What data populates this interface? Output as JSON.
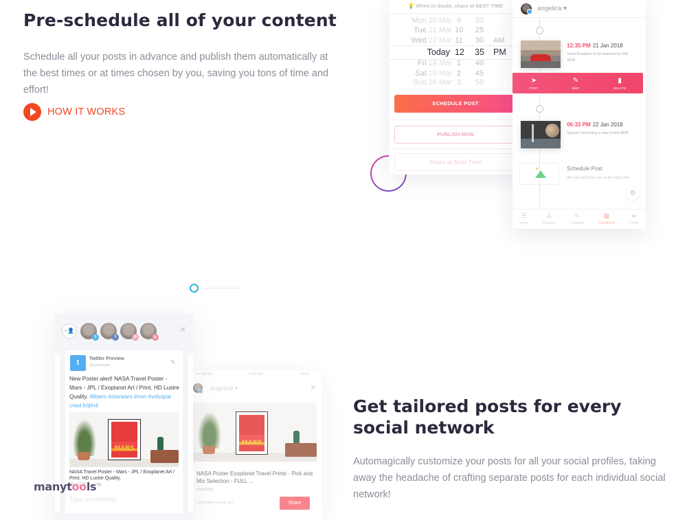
{
  "section_schedule": {
    "title": "Pre-schedule all of your content",
    "description": "Schedule all your posts in advance and publish them automatically at the best times or at times chosen by you, saving you tons of time and effort!",
    "cta_label": "HOW IT WORKS",
    "accent_color": "#f2461f"
  },
  "date_picker": {
    "tip": "When in doubt, share at BEST TIME",
    "rows": [
      {
        "day": "Mon",
        "date": "20 Mar",
        "hour": "9",
        "minute": "20",
        "ampm": ""
      },
      {
        "day": "Tue",
        "date": "21 Mar",
        "hour": "10",
        "minute": "25",
        "ampm": ""
      },
      {
        "day": "Wed",
        "date": "22 Mar",
        "hour": "11",
        "minute": "30",
        "ampm": "AM"
      },
      {
        "day": "Today",
        "date": "",
        "hour": "12",
        "minute": "35",
        "ampm": "PM"
      },
      {
        "day": "Fri",
        "date": "24 Mar",
        "hour": "1",
        "minute": "40",
        "ampm": ""
      },
      {
        "day": "Sat",
        "date": "25 Mar",
        "hour": "2",
        "minute": "45",
        "ampm": ""
      },
      {
        "day": "Sun",
        "date": "26 Mar",
        "hour": "3",
        "minute": "50",
        "ampm": ""
      }
    ],
    "schedule_button": "SCHEDULE POST",
    "publish_button": "PUBLISH NOW",
    "best_time_button": "Share at Best Time"
  },
  "timeline": {
    "username": "angelica",
    "posts": [
      {
        "time": "12:35 PM",
        "date": "21 Jan 2018",
        "description": "Tesla Roadster to hit markets by Mid 2018"
      },
      {
        "time": "06:33 PM",
        "date": "22 Jan 2018",
        "description": "SpaceX launching a new rocket BFR"
      }
    ],
    "actions": [
      {
        "icon": "send-icon",
        "glyph": "➤",
        "label": "POST"
      },
      {
        "icon": "pencil-icon",
        "glyph": "✎",
        "label": "EDIT"
      },
      {
        "icon": "trash-icon",
        "glyph": "🗑",
        "label": "DELETE"
      }
    ],
    "schedule_slot": {
      "title": "Schedule Post",
      "subtitle": "We will post it for you at the right time"
    },
    "tabs": [
      {
        "icon": "home-icon",
        "glyph": "☰",
        "label": "Home",
        "active": false
      },
      {
        "icon": "manage-icon",
        "glyph": "⟁",
        "label": "Manage",
        "active": false
      },
      {
        "icon": "compose-icon",
        "glyph": "✎",
        "label": "Compose",
        "active": false
      },
      {
        "icon": "calendar-icon",
        "glyph": "▦",
        "label": "Scheduled",
        "active": true
      },
      {
        "icon": "profile-icon",
        "glyph": "●",
        "label": "Profile",
        "active": false
      }
    ]
  },
  "composer": {
    "profiles": [
      {
        "network": "twitter",
        "badge_glyph": "t",
        "color": "#5bb6f0"
      },
      {
        "network": "facebook",
        "badge_glyph": "f",
        "color": "#6f86c4"
      },
      {
        "network": "instagram",
        "badge_glyph": "◎",
        "color": "#f3a3b8"
      },
      {
        "network": "pinterest",
        "badge_glyph": "p",
        "color": "#ef8a9a"
      }
    ],
    "preview": {
      "title": "Twitter Preview",
      "username": "@username",
      "text_plain": "New Poster alert! NASA Travel Poster - Mars - JPL / Exoplanet Art  / Print. HD Lustre Quality. ",
      "hashtags": "#libero #starwars #non #volutpat",
      "short_link": "crwd.fr/jkh4",
      "link_title": "NASA Travel Poster - Mars - JPL / Exoplanet Art  / Print. HD Lustre Quality.",
      "link_domain": "etsy.com",
      "poster_label": "MARS"
    },
    "input_placeholder": "Type something"
  },
  "phone_preview": {
    "carrier": "••• Sketch",
    "time": "9:41 AM",
    "battery": "100%",
    "username": "angelica",
    "link_title": "NASA Poster Exoplanet Travel Prints - Pick and Mix Selection - FULL ...",
    "link_domain": "etsy.com",
    "last_posted": "Last Posted a week ago",
    "share_button": "Share",
    "poster_label": "MARS"
  },
  "section_tailored": {
    "title": "Get tailored posts for every social network",
    "description": "Automagically customize your posts for all your social profiles, taking away the headache of crafting separate posts for each individual social network!"
  },
  "watermark": {
    "text_a": "manyt",
    "text_oo": "oo",
    "text_b": "ls",
    "tm": "TM"
  }
}
